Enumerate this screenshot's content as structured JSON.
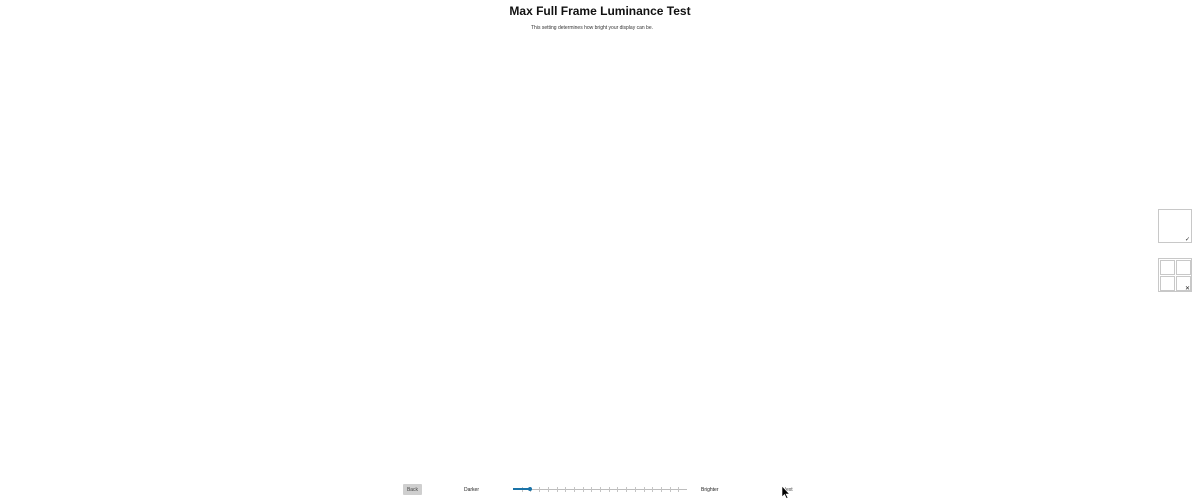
{
  "header": {
    "title": "Max Full Frame Luminance Test",
    "subtitle": "This setting determines how bright your display can be."
  },
  "previews": {
    "good": {
      "icon": "checkmark-icon",
      "glyph": "✓"
    },
    "bad": {
      "icon": "x-icon",
      "glyph": "✕"
    }
  },
  "footer": {
    "back_label": "Back",
    "darker_label": "Darker",
    "brighter_label": "Brighter",
    "next_label": "Next"
  },
  "slider": {
    "min": 0,
    "max": 20,
    "value": 2,
    "accent_color": "#1a73a8"
  }
}
